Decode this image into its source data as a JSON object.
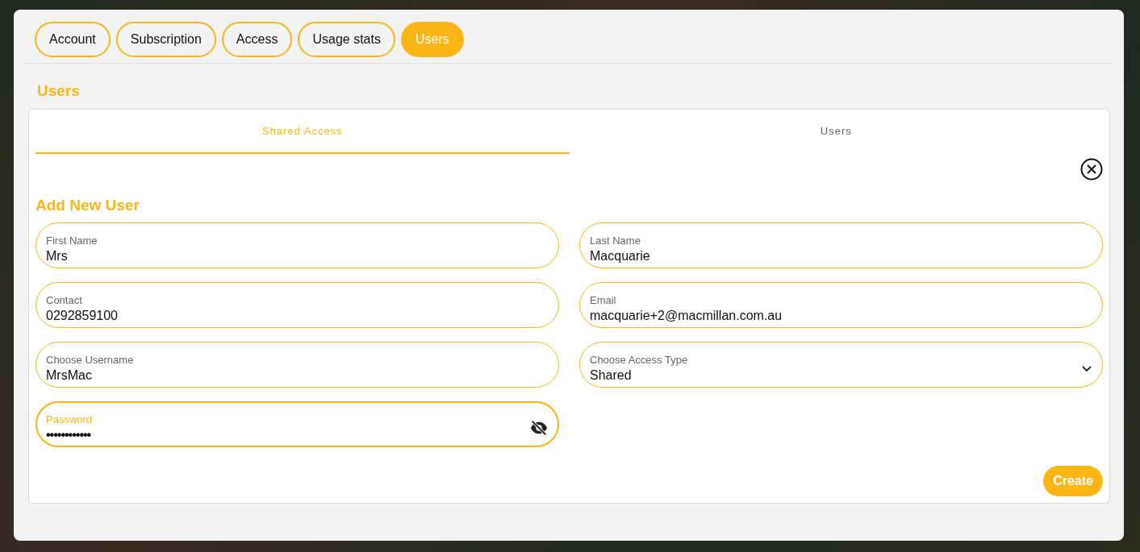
{
  "tabs": [
    {
      "label": "Account",
      "selected": false
    },
    {
      "label": "Subscription",
      "selected": false
    },
    {
      "label": "Access",
      "selected": false
    },
    {
      "label": "Usage stats",
      "selected": false
    },
    {
      "label": "Users",
      "selected": true
    }
  ],
  "section_title": "Users",
  "subtabs": [
    {
      "label": "Shared Access",
      "selected": true
    },
    {
      "label": "Users",
      "selected": false
    }
  ],
  "form": {
    "title": "Add New User",
    "fields": [
      {
        "kind": "text",
        "label": "First Name",
        "value": "Mrs",
        "focused": false
      },
      {
        "kind": "text",
        "label": "Last Name",
        "value": "Macquarie",
        "focused": false
      },
      {
        "kind": "text",
        "label": "Contact",
        "value": "0292859100",
        "focused": false
      },
      {
        "kind": "text",
        "label": "Email",
        "value": "macquarie+2@macmillan.com.au",
        "focused": false
      },
      {
        "kind": "text",
        "label": "Choose Username",
        "value": "MrsMac",
        "focused": false
      },
      {
        "kind": "select",
        "label": "Choose Access Type",
        "value": "Shared",
        "focused": false
      },
      {
        "kind": "password",
        "label": "Password",
        "value": "••••••••••••",
        "focused": true
      }
    ],
    "submit": "Create"
  }
}
